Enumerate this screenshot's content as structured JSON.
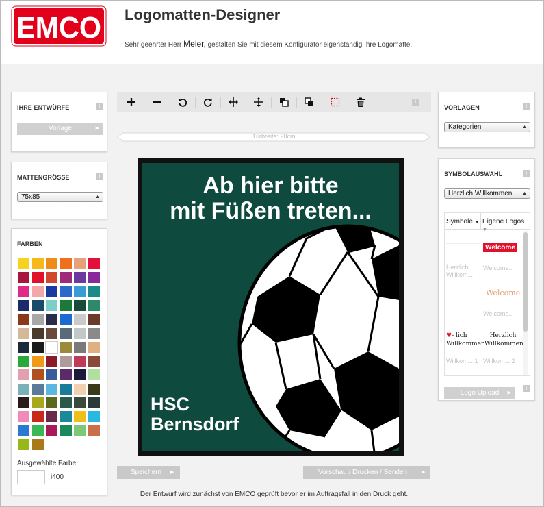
{
  "header": {
    "title": "Logomatten-Designer",
    "greeting_prefix": "Sehr geehrter Herr",
    "greeting_name": "Meier,",
    "greeting_suffix": "gestalten Sie mit diesem Konfigurator eigenständig Ihre Logomatte.",
    "logo_text": "EMCO",
    "brand_color": "#e2001a"
  },
  "left": {
    "drafts": {
      "title": "IHRE ENTWÜRFE",
      "button": "Vorlage"
    },
    "size": {
      "title": "MATTENGRÖSSE",
      "selected": "75x85"
    },
    "colors": {
      "title": "FARBEN",
      "swatches": [
        "#f5d31f",
        "#f7b81c",
        "#f08a1a",
        "#ef6f1a",
        "#e6a27a",
        "#e2103a",
        "#a8173e",
        "#e2102a",
        "#d0492e",
        "#a02a7a",
        "#6a3aa0",
        "#8a2a9a",
        "#e02a8a",
        "#f2a8a8",
        "#1a3aa0",
        "#2a6ac8",
        "#3a9ad8",
        "#1a8a8a",
        "#1a2a6a",
        "#1a4a6a",
        "#7ad0c8",
        "#1a7a3a",
        "#1a4a3a",
        "#2a8a6a",
        "#8a3a1a",
        "#a8a8a8",
        "#2a2a4a",
        "#1a6ad0",
        "#cacaca",
        "#6a3a2a",
        "#d4b89a",
        "#4a3a2a",
        "#6a4a3a",
        "#5a6a7a",
        "#c0c8c8",
        "#8a8a8a",
        "#1a2a3a",
        "#1a1a1a",
        "#ffffff",
        "#9a8a3a",
        "#7a7a7a",
        "#e0b080",
        "#2aa83a",
        "#f09a1a",
        "#8a1a2a",
        "#b09a9a",
        "#c03a5a",
        "#8a4a3a",
        "#e0a0b0",
        "#b05020",
        "#3a5a9a",
        "#5a2a6a",
        "#1a1a3a",
        "#b0e0a0",
        "#7ab0b8",
        "#5a7a9a",
        "#5ab8e0",
        "#1a7a9a",
        "#f0d0b0",
        "#3a3a1a",
        "#2a1a1a",
        "#a8a81a",
        "#5a6a1a",
        "#2a5a4a",
        "#3a4a3a",
        "#2a3a3a",
        "#f08ab8",
        "#c82a1a",
        "#6a2a4a",
        "#1a8a9a",
        "#f0c01a",
        "#2ab8e0",
        "#2a7ad0",
        "#3ab858",
        "#a81a5a",
        "#1a8a5a",
        "#7ac878",
        "#c8704a",
        "#98b81a",
        "#a87a1a"
      ],
      "selected_label": "Ausgewählte Farbe:",
      "selected_code": "i400"
    }
  },
  "toolbar": {
    "icons": [
      "plus-icon",
      "minus-icon",
      "rotate-left-icon",
      "rotate-right-icon",
      "center-horizontal-icon",
      "center-vertical-icon",
      "bring-forward-icon",
      "send-backward-icon",
      "frame-icon",
      "trash-icon"
    ]
  },
  "canvas": {
    "ruler_label": "Türbreite: 90cm",
    "mat_line1": "Ab hier bitte",
    "mat_line2": "mit Füßen treten...",
    "mat_club1": "HSC",
    "mat_club2": "Bernsdorf",
    "mat_color": "#0f4a3f"
  },
  "right": {
    "templates": {
      "title": "VORLAGEN",
      "selected": "Kategorien"
    },
    "symbols": {
      "title": "SYMBOLAUSWAHL",
      "selected": "Herzlich Willkommen",
      "tab_symbols": "Symbole",
      "tab_logos": "Eigene Logos",
      "items": [
        {
          "caption": "Herzlich Willkom...",
          "art": ""
        },
        {
          "caption": "Welcome...",
          "art": "Welcome"
        },
        {
          "caption": "",
          "art": "Welcome"
        },
        {
          "caption": "Welcome...",
          "art": ""
        },
        {
          "caption": "Willkom... 1",
          "art": "Willkommen"
        },
        {
          "caption": "Willkom... 2",
          "art": "Herzlich Willkommen"
        }
      ],
      "upload": "Logo Upload"
    }
  },
  "footer": {
    "save": "Speichern",
    "preview": "Vorschau / Drucken / Senden",
    "note": "Der Entwurf wird zunächst von EMCO geprüft bevor er im Auftragsfall in den Druck geht."
  }
}
